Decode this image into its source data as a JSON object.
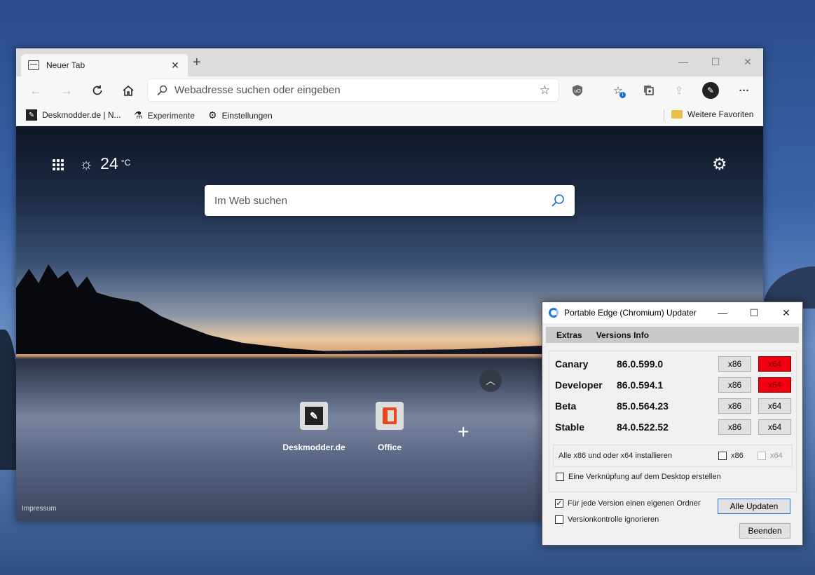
{
  "edge": {
    "tab_title": "Neuer Tab",
    "address_placeholder": "Webadresse suchen oder eingeben",
    "favorites": {
      "items": [
        "Deskmodder.de | N...",
        "Experimente",
        "Einstellungen"
      ],
      "more": "Weitere Favoriten"
    },
    "ntp": {
      "temperature": "24",
      "unit": "°C",
      "search_placeholder": "Im Web suchen",
      "tiles": [
        "Deskmodder.de",
        "Office"
      ],
      "footer": "Impressum"
    }
  },
  "updater": {
    "title": "Portable Edge (Chromium) Updater",
    "menu": [
      "Extras",
      "Versions Info"
    ],
    "channels": [
      {
        "name": "Canary",
        "version": "86.0.599.0",
        "x86": "x86",
        "x64": "x64",
        "x64_highlight": true
      },
      {
        "name": "Developer",
        "version": "86.0.594.1",
        "x86": "x86",
        "x64": "x64",
        "x64_highlight": true
      },
      {
        "name": "Beta",
        "version": "85.0.564.23",
        "x86": "x86",
        "x64": "x64",
        "x64_highlight": false
      },
      {
        "name": "Stable",
        "version": "84.0.522.52",
        "x86": "x86",
        "x64": "x64",
        "x64_highlight": false
      }
    ],
    "install_all": {
      "label": "Alle x86 und oder x64 installieren",
      "x86": "x86",
      "x64": "x64",
      "x86_checked": false,
      "x64_enabled": false
    },
    "desktop_shortcut": {
      "label": "Eine Verknüpfung auf dem Desktop erstellen",
      "checked": false
    },
    "own_folder": {
      "label": "Für jede Version einen eigenen Ordner",
      "checked": true
    },
    "ignore_version": {
      "label": "Versionkontrolle ignorieren",
      "checked": false
    },
    "update_all": "Alle Updaten",
    "quit": "Beenden"
  },
  "colors": {
    "highlight_red": "#f00010",
    "accent_blue": "#1f7ad8"
  }
}
